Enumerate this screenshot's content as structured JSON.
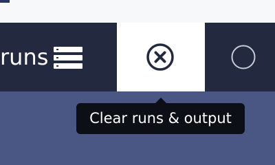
{
  "toolbar": {
    "runs_button": {
      "label": "runs",
      "icon": "list-icon"
    },
    "clear_button": {
      "icon": "close-circle-icon"
    },
    "status": {
      "icon": "circle-outline-icon"
    }
  },
  "tooltip": {
    "text": "Clear runs & output"
  },
  "colors": {
    "toolbar_bg": "#232a3f",
    "page_bg": "#4a5784",
    "active_bg": "#ffffff",
    "tooltip_bg": "#0d0f16",
    "icon_dark": "#232a3f"
  }
}
